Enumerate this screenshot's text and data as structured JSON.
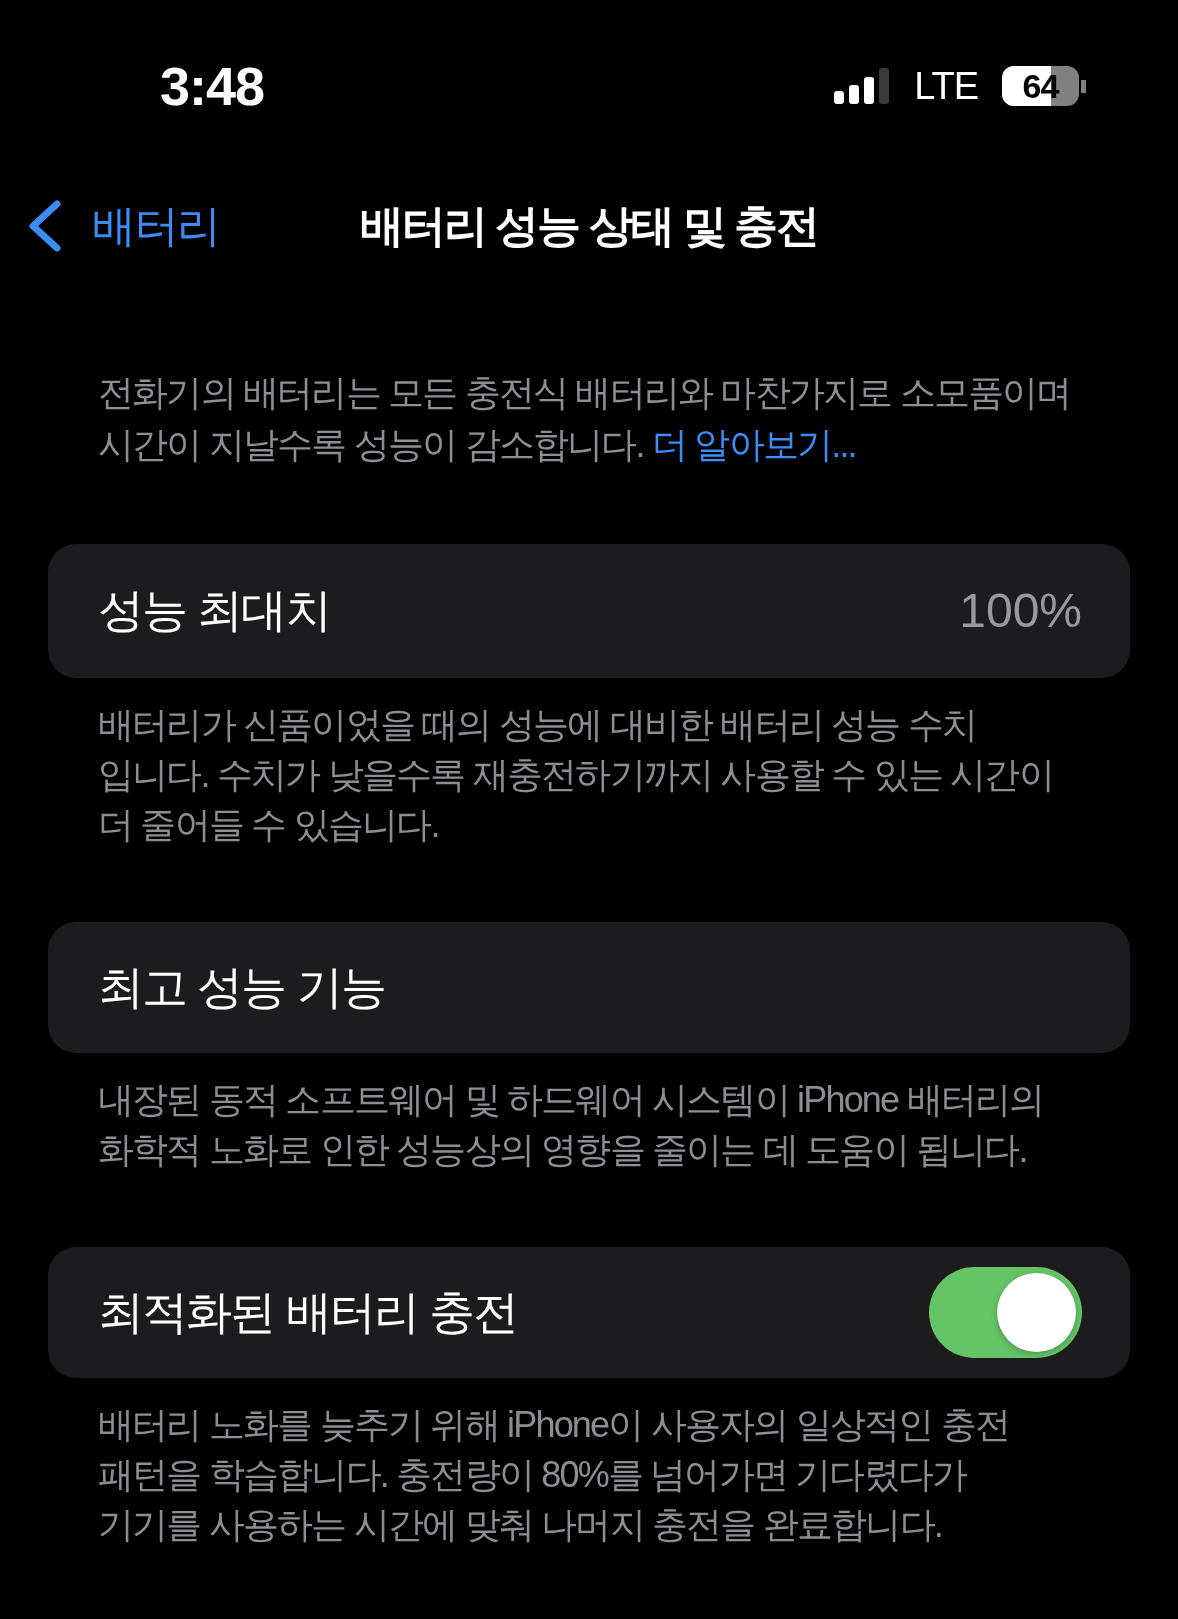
{
  "status_bar": {
    "time": "3:48",
    "network": "LTE",
    "battery": {
      "level": 0.64,
      "reading": "64"
    }
  },
  "nav": {
    "back_label": "배터리",
    "title": "배터리 성능 상태 및 충전"
  },
  "intro": {
    "text": "전화기의 배터리는 모든 충전식 배터리와 마찬가지로 소모품이며\n시간이 지날수록 성능이 감소합니다.",
    "link": "더 알아보기..."
  },
  "sections": [
    {
      "kind": "value",
      "label": "성능 최대치",
      "value": "100%",
      "footer": "배터리가 신품이었을 때의 성능에 대비한 배터리 성능 수치\n입니다. 수치가 낮을수록 재충전하기까지 사용할 수 있는 시간이\n더 줄어들 수 있습니다."
    },
    {
      "kind": "plain",
      "label": "최고 성능 기능",
      "footer": "내장된 동적 소프트웨어 및 하드웨어 시스템이 iPhone 배터리의\n화학적 노화로 인한 성능상의 영향을 줄이는 데 도움이 됩니다."
    },
    {
      "kind": "toggle",
      "label": "최적화된 배터리 충전",
      "on": true,
      "footer": "배터리 노화를 늦추기 위해 iPhone이 사용자의 일상적인 충전\n패턴을 학습합니다. 충전량이 80%를 넘어가면 기다렸다가\n기기를 사용하는 시간에 맞춰 나머지 충전을 완료합니다."
    }
  ]
}
